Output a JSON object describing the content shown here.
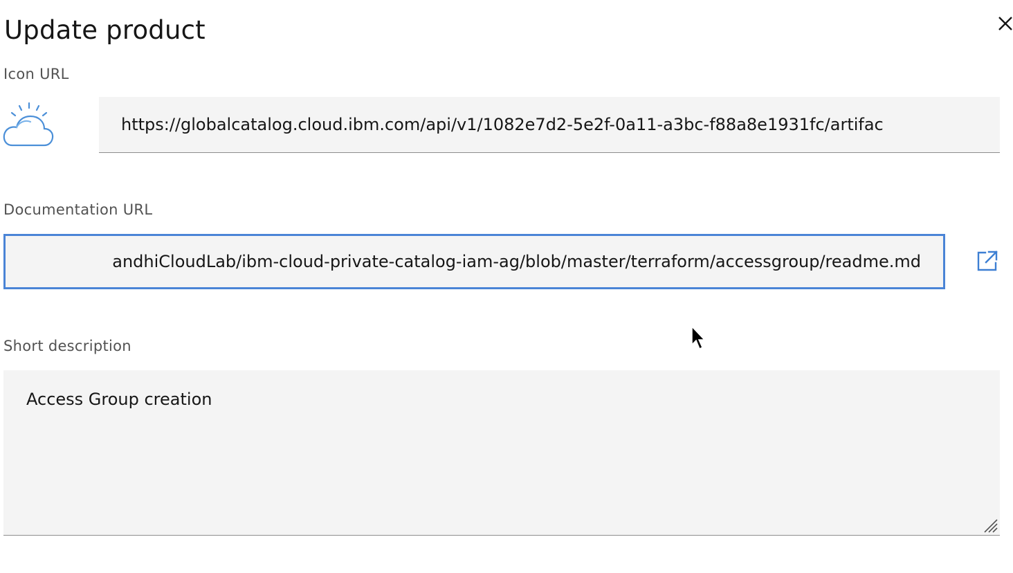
{
  "dialog": {
    "title": "Update product",
    "close_icon": "close-icon"
  },
  "icon_url": {
    "label": "Icon URL",
    "value": "https://globalcatalog.cloud.ibm.com/api/v1/1082e7d2-5e2f-0a11-a3bc-f88a8e1931fc/artifac",
    "preview_icon": "ibm-cloud-logo-icon"
  },
  "documentation_url": {
    "label": "Documentation URL",
    "value": "andhiCloudLab/ibm-cloud-private-catalog-iam-ag/blob/master/terraform/accessgroup/readme.md",
    "link_icon": "external-link-icon"
  },
  "short_description": {
    "label": "Short description",
    "value": "Access Group creation"
  },
  "colors": {
    "focus_border": "#4a84d6",
    "field_bg": "#f4f4f4",
    "label": "#525252",
    "text": "#161616"
  }
}
